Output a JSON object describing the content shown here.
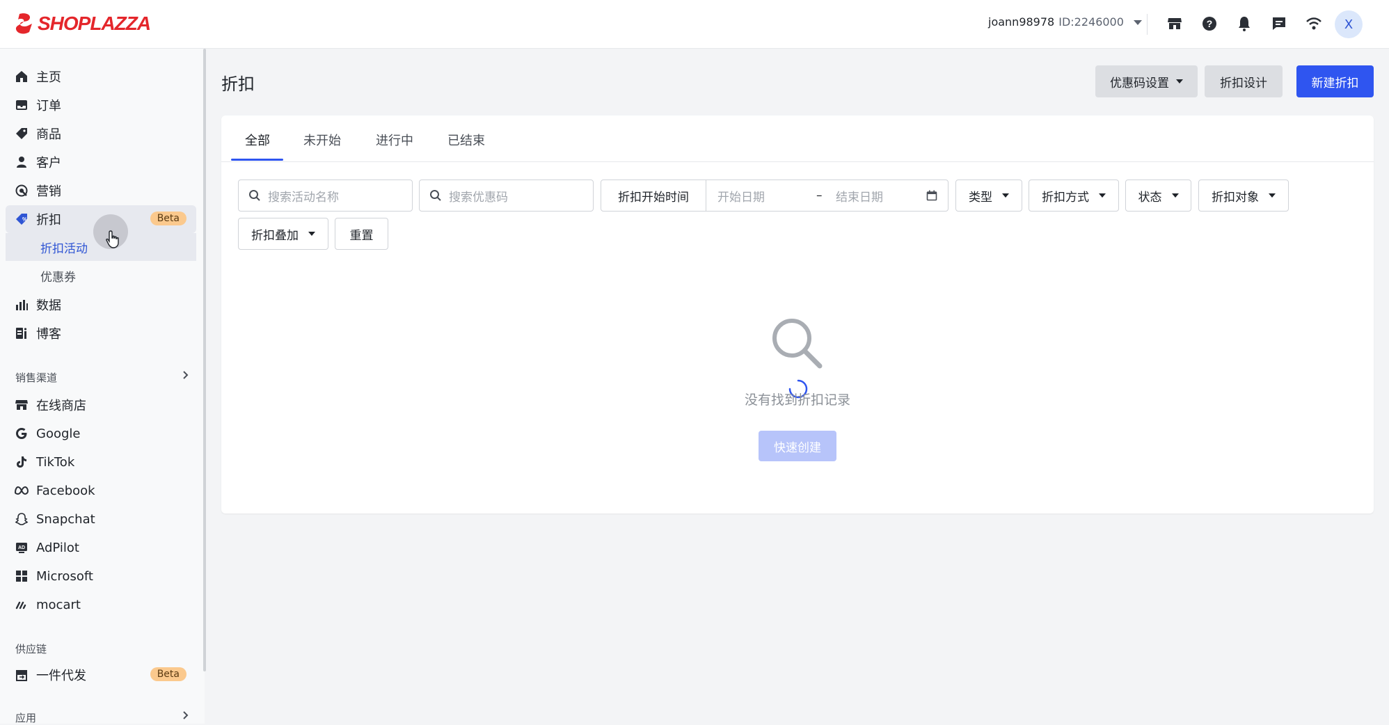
{
  "brand": {
    "name": "SHOPLAZZA",
    "color": "#e4262b"
  },
  "header": {
    "username": "joann98978",
    "user_id": "ID:2246000",
    "avatar_letter": "X",
    "icons": [
      "store-icon",
      "help-icon",
      "bell-icon",
      "chat-icon",
      "wifi-icon"
    ]
  },
  "sidebar": {
    "items": [
      {
        "label": "主页",
        "icon": "home-icon"
      },
      {
        "label": "订单",
        "icon": "inbox-icon"
      },
      {
        "label": "商品",
        "icon": "tag-icon"
      },
      {
        "label": "客户",
        "icon": "person-icon"
      },
      {
        "label": "营销",
        "icon": "target-icon"
      },
      {
        "label": "折扣",
        "icon": "discount-icon",
        "badge": "Beta",
        "active": true
      },
      {
        "label": "数据",
        "icon": "bar-chart-icon"
      },
      {
        "label": "博客",
        "icon": "blog-icon"
      }
    ],
    "sub_items": [
      {
        "label": "折扣活动",
        "active": true
      },
      {
        "label": "优惠券"
      }
    ],
    "sales_channels_title": "销售渠道",
    "channels": [
      {
        "label": "在线商店",
        "icon": "store-icon"
      },
      {
        "label": "Google",
        "icon": "google-icon"
      },
      {
        "label": "TikTok",
        "icon": "tiktok-icon"
      },
      {
        "label": "Facebook",
        "icon": "meta-icon"
      },
      {
        "label": "Snapchat",
        "icon": "snapchat-icon"
      },
      {
        "label": "AdPilot",
        "icon": "ad-icon"
      },
      {
        "label": "Microsoft",
        "icon": "microsoft-icon"
      },
      {
        "label": "mocart",
        "icon": "mocart-icon"
      }
    ],
    "supply_title": "供应链",
    "supply_items": [
      {
        "label": "一件代发",
        "icon": "dropship-icon",
        "badge": "Beta"
      }
    ],
    "apps_title": "应用"
  },
  "page": {
    "title": "折扣",
    "coupon_settings_label": "优惠码设置",
    "discount_design_label": "折扣设计",
    "new_discount_label": "新建折扣"
  },
  "tabs": [
    "全部",
    "未开始",
    "进行中",
    "已结束"
  ],
  "filters": {
    "search_activity_placeholder": "搜索活动名称",
    "search_code_placeholder": "搜索优惠码",
    "start_time_label": "折扣开始时间",
    "start_date_placeholder": "开始日期",
    "date_separator": "–",
    "end_date_placeholder": "结束日期",
    "type_label": "类型",
    "method_label": "折扣方式",
    "status_label": "状态",
    "target_label": "折扣对象",
    "stacking_label": "折扣叠加",
    "reset_label": "重置"
  },
  "empty_state": {
    "message": "没有找到折扣记录",
    "quick_create_label": "快速创建"
  },
  "colors": {
    "accent": "#2f55f0",
    "badge": "#fbc98d",
    "active_sub": "#2f55d4"
  }
}
